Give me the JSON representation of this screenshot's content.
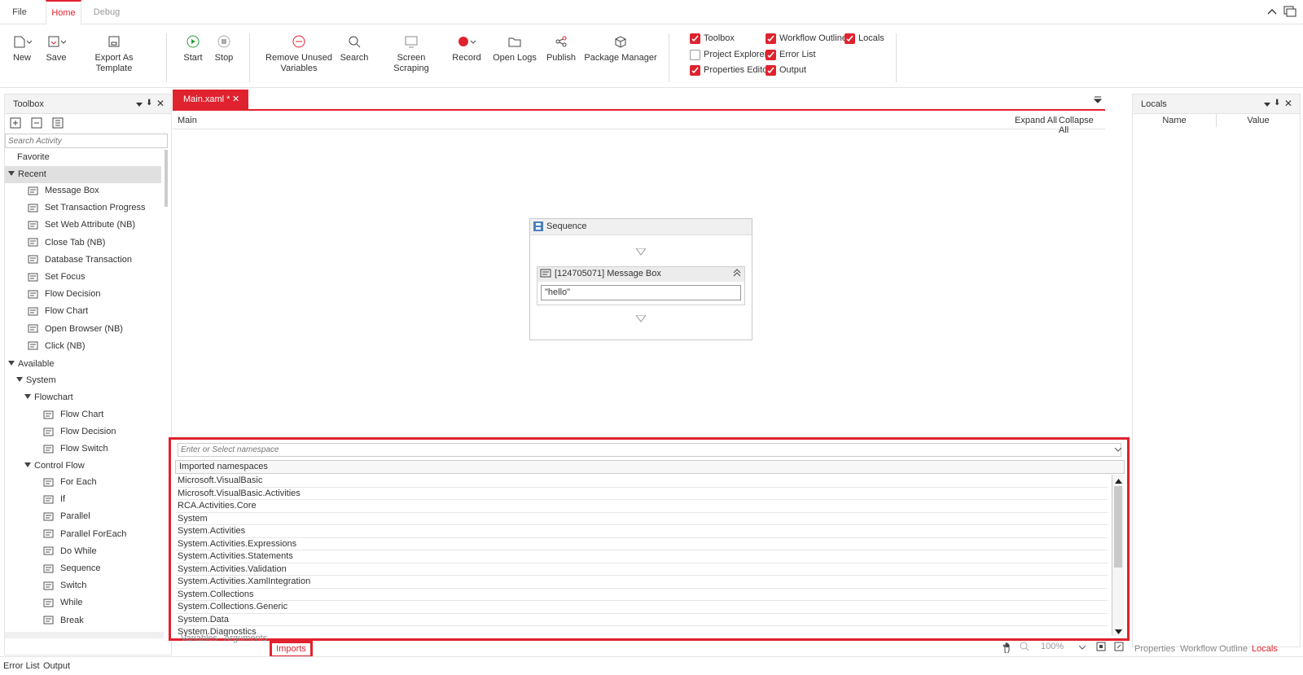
{
  "menu": {
    "file": "File",
    "home": "Home",
    "debug": "Debug"
  },
  "ribbon": {
    "new": "New",
    "save": "Save",
    "export": "Export As Template",
    "start": "Start",
    "stop": "Stop",
    "remove_unused_1": "Remove Unused",
    "remove_unused_2": "Variables",
    "search": "Search",
    "screen_scraping": "Screen Scraping",
    "record": "Record",
    "open_logs": "Open Logs",
    "publish": "Publish",
    "package_manager": "Package Manager"
  },
  "panels_toggle": [
    {
      "label": "Toolbox",
      "checked": true
    },
    {
      "label": "Workflow Outline",
      "checked": true
    },
    {
      "label": "Locals",
      "checked": true
    },
    {
      "label": "Project Explorer",
      "checked": false
    },
    {
      "label": "Error List",
      "checked": true
    },
    {
      "label": "Properties Editor",
      "checked": true
    },
    {
      "label": "Output",
      "checked": true
    }
  ],
  "toolbox": {
    "title": "Toolbox",
    "search_placeholder": "Search Activity",
    "favorite": "Favorite",
    "recent": "Recent",
    "recent_items": [
      "Message Box",
      "Set Transaction Progress",
      "Set Web Attribute (NB)",
      "Close Tab (NB)",
      "Database Transaction",
      "Set Focus",
      "Flow Decision",
      "Flow Chart",
      "Open Browser (NB)",
      "Click (NB)"
    ],
    "available": "Available",
    "system": "System",
    "flowchart": "Flowchart",
    "flowchart_items": [
      "Flow Chart",
      "Flow Decision",
      "Flow Switch"
    ],
    "control_flow": "Control Flow",
    "control_items": [
      "For Each",
      "If",
      "Parallel",
      "Parallel ForEach",
      "Do While",
      "Sequence",
      "Switch",
      "While",
      "Break"
    ]
  },
  "doc_tab": {
    "label": "Main.xaml *"
  },
  "designer": {
    "breadcrumb": "Main",
    "expand_all": "Expand All",
    "collapse_all": "Collapse All",
    "sequence_title": "Sequence",
    "message_box_title": "[124705071] Message Box",
    "message_box_value": "\"hello\""
  },
  "imports": {
    "placeholder": "Enter or Select namespace",
    "header": "Imported namespaces",
    "namespaces": [
      "Microsoft.VisualBasic",
      "Microsoft.VisualBasic.Activities",
      "RCA.Activities.Core",
      "System",
      "System.Activities",
      "System.Activities.Expressions",
      "System.Activities.Statements",
      "System.Activities.Validation",
      "System.Activities.XamlIntegration",
      "System.Collections",
      "System.Collections.Generic",
      "System.Data",
      "System.Diagnostics"
    ]
  },
  "bottom_tabs": {
    "variables": "Variables",
    "arguments": "Arguments",
    "imports": "Imports"
  },
  "zoom": "100%",
  "locals": {
    "title": "Locals",
    "col_name": "Name",
    "col_value": "Value"
  },
  "right_tabs": {
    "properties": "Properties",
    "workflow_outline": "Workflow Outline",
    "locals": "Locals"
  },
  "footer_tabs": {
    "error_list": "Error List",
    "output": "Output"
  },
  "colors": {
    "accent": "#e0222e",
    "highlight_border": "#e0222e"
  }
}
